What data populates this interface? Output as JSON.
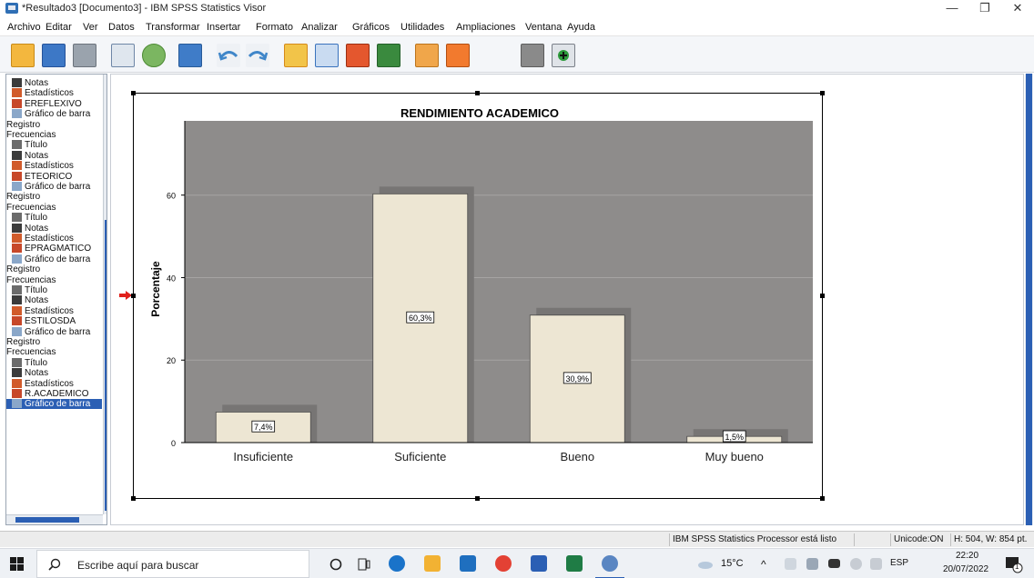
{
  "window": {
    "title": "*Resultado3 [Documento3] - IBM SPSS Statistics Visor",
    "minimize": "—",
    "restore": "❐",
    "close": "✕"
  },
  "menu": [
    "Archivo",
    "Editar",
    "Ver",
    "Datos",
    "Transformar",
    "Insertar",
    "Formato",
    "Analizar",
    "Gráficos",
    "Utilidades",
    "Ampliaciones",
    "Ventana",
    "Ayuda"
  ],
  "toolbar_icons": [
    "open-folder-icon",
    "save-icon",
    "print-icon",
    "print-preview-icon",
    "export-icon",
    "recall-dialog-icon",
    "undo-icon",
    "redo-icon",
    "goto-data-icon",
    "goto-case-icon",
    "goto-variable-icon",
    "variables-icon",
    "insert-output-icon",
    "designate-window-icon",
    "hide-icon",
    "promote-icon"
  ],
  "outline": {
    "rows": [
      {
        "label": "Notas",
        "icon": "notes-icon"
      },
      {
        "label": "Estadísticos",
        "icon": "stats-icon"
      },
      {
        "label": "EREFLEXIVO",
        "icon": "table-icon"
      },
      {
        "label": "Gráfico de barra",
        "icon": "chart-icon"
      },
      {
        "label": "Registro",
        "icon": ""
      },
      {
        "label": "Frecuencias",
        "icon": ""
      },
      {
        "label": "Título",
        "icon": "title-icon"
      },
      {
        "label": "Notas",
        "icon": "notes-icon"
      },
      {
        "label": "Estadísticos",
        "icon": "stats-icon"
      },
      {
        "label": "ETEORICO",
        "icon": "table-icon"
      },
      {
        "label": "Gráfico de barra",
        "icon": "chart-icon"
      },
      {
        "label": "Registro",
        "icon": ""
      },
      {
        "label": "Frecuencias",
        "icon": ""
      },
      {
        "label": "Título",
        "icon": "title-icon"
      },
      {
        "label": "Notas",
        "icon": "notes-icon"
      },
      {
        "label": "Estadísticos",
        "icon": "stats-icon"
      },
      {
        "label": "EPRAGMATICO",
        "icon": "table-icon"
      },
      {
        "label": "Gráfico de barra",
        "icon": "chart-icon"
      },
      {
        "label": "Registro",
        "icon": ""
      },
      {
        "label": "Frecuencias",
        "icon": ""
      },
      {
        "label": "Título",
        "icon": "title-icon"
      },
      {
        "label": "Notas",
        "icon": "notes-icon"
      },
      {
        "label": "Estadísticos",
        "icon": "stats-icon"
      },
      {
        "label": "ESTILOSDA",
        "icon": "table-icon"
      },
      {
        "label": "Gráfico de barra",
        "icon": "chart-icon"
      },
      {
        "label": "Registro",
        "icon": ""
      },
      {
        "label": "Frecuencias",
        "icon": ""
      },
      {
        "label": "Título",
        "icon": "title-icon"
      },
      {
        "label": "Notas",
        "icon": "notes-icon"
      },
      {
        "label": "Estadísticos",
        "icon": "stats-icon"
      },
      {
        "label": "R.ACADEMICO",
        "icon": "table-icon"
      },
      {
        "label": "Gráfico de barra",
        "icon": "chart-icon",
        "selected": true
      }
    ]
  },
  "chart_data": {
    "type": "bar",
    "title": "RENDIMIENTO ACADEMICO",
    "ylabel": "Porcentaje",
    "xlabel": "",
    "categories": [
      "Insuficiente",
      "Suficiente",
      "Bueno",
      "Muy bueno"
    ],
    "values": [
      7.4,
      60.3,
      30.9,
      1.5
    ],
    "data_labels": [
      "7,4%",
      "60,3%",
      "30,9%",
      "1,5%"
    ],
    "yticks": [
      0,
      20,
      40,
      60
    ],
    "ylim": [
      0,
      78
    ],
    "grid": true,
    "colors": {
      "plot_bg": "#8e8c8b",
      "bar": "#ede6d3",
      "shadow": "#777574",
      "grid": "#a6a4a3"
    }
  },
  "status": {
    "processor": "IBM SPSS Statistics Processor está listo",
    "unicode": "Unicode:ON",
    "size": "H: 504, W: 854 pt."
  },
  "taskbar": {
    "search_placeholder": "Escribe aquí para buscar",
    "temperature": "15°C",
    "language": "ESP",
    "time": "22:20",
    "date": "20/07/2022",
    "notifications": "1"
  }
}
